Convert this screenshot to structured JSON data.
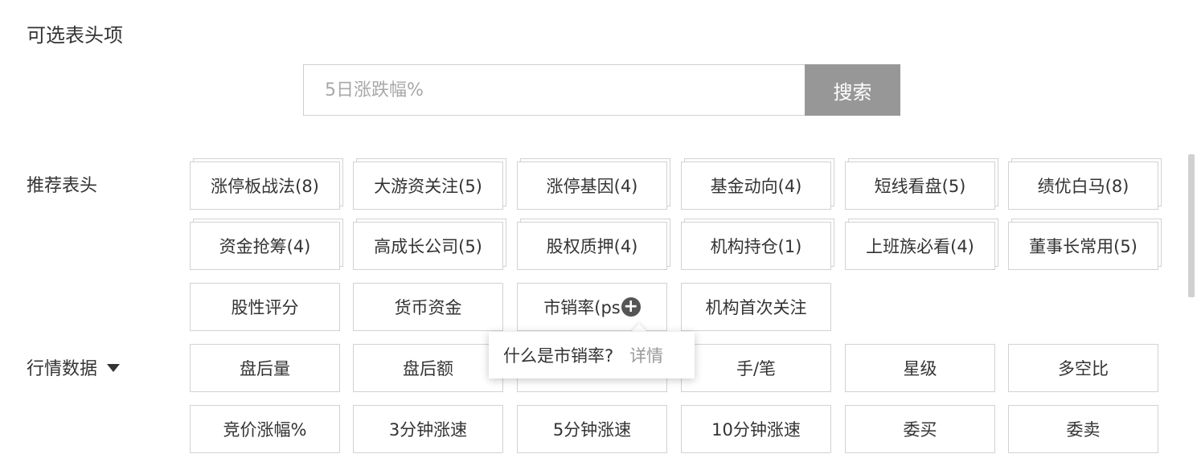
{
  "title": "可选表头项",
  "search": {
    "placeholder": "5日涨跌幅%",
    "button_label": "搜索"
  },
  "sections": {
    "recommended": {
      "label": "推荐表头",
      "rows": [
        [
          "涨停板战法(8)",
          "大游资关注(5)",
          "涨停基因(4)",
          "基金动向(4)",
          "短线看盘(5)",
          "绩优白马(8)"
        ],
        [
          "资金抢筹(4)",
          "高成长公司(5)",
          "股权质押(4)",
          "机构持仓(1)",
          "上班族必看(4)",
          "董事长常用(5)"
        ],
        [
          "股性评分",
          "货币资金",
          "市销率(ps",
          "机构首次关注"
        ]
      ]
    },
    "market": {
      "label": "行情数据",
      "rows": [
        [
          "盘后量",
          "盘后额",
          "",
          "手/笔",
          "星级",
          "多空比"
        ],
        [
          "竞价涨幅%",
          "3分钟涨速",
          "5分钟涨速",
          "10分钟涨速",
          "委买",
          "委卖"
        ]
      ]
    }
  },
  "tooltip": {
    "text": "什么是市销率?",
    "link": "详情"
  }
}
